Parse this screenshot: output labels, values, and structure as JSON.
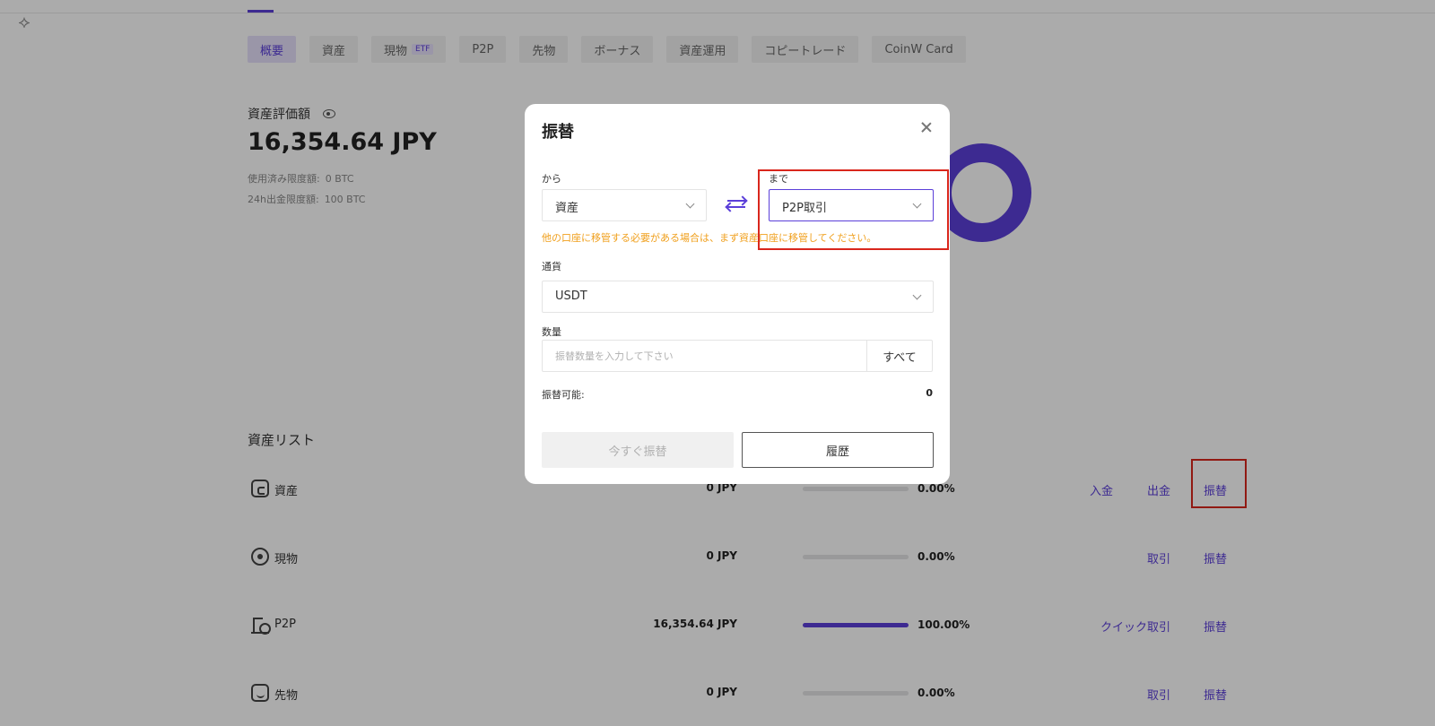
{
  "header": {
    "tabs": [
      {
        "label": "概要",
        "active": true
      },
      {
        "label": "資産"
      },
      {
        "label": "現物",
        "badge": "ETF"
      },
      {
        "label": "P2P"
      },
      {
        "label": "先物"
      },
      {
        "label": "ボーナス"
      },
      {
        "label": "資産運用"
      },
      {
        "label": "コピートレード"
      },
      {
        "label": "CoinW Card"
      }
    ]
  },
  "summary": {
    "title": "資産評価額",
    "total": "16,354.64 JPY",
    "used_limit_label": "使用済み限度額:",
    "used_limit_value": "0 BTC",
    "withdraw_limit_label": "24h出金限度額:",
    "withdraw_limit_value": "100 BTC"
  },
  "asset_list": {
    "title": "資産リスト",
    "rows": [
      {
        "name": "資産",
        "amount": "0 JPY",
        "percent": "0.00%",
        "fill": 0,
        "actions": [
          "入金",
          "出金",
          "振替"
        ]
      },
      {
        "name": "現物",
        "amount": "0 JPY",
        "percent": "0.00%",
        "fill": 0,
        "actions": [
          "取引",
          "振替"
        ]
      },
      {
        "name": "P2P",
        "amount": "16,354.64 JPY",
        "percent": "100.00%",
        "fill": 100,
        "actions": [
          "クイック取引",
          "振替"
        ]
      },
      {
        "name": "先物",
        "amount": "0 JPY",
        "percent": "0.00%",
        "fill": 0,
        "actions": [
          "取引",
          "振替"
        ]
      }
    ]
  },
  "modal": {
    "title": "振替",
    "from_label": "から",
    "from_value": "資産",
    "to_label": "まで",
    "to_value": "P2P取引",
    "hint": "他の口座に移管する必要がある場合は、まず資産口座に移管してください。",
    "currency_label": "通貨",
    "currency_value": "USDT",
    "quantity_label": "数量",
    "quantity_placeholder": "振替数量を入力して下さい",
    "all_label": "すべて",
    "available_label": "振替可能:",
    "available_value": "0",
    "transfer_button": "今すぐ振替",
    "history_button": "履歴"
  },
  "colors": {
    "accent": "#5b3fd9",
    "warning": "#f0a01e",
    "highlight": "#d9261c"
  }
}
